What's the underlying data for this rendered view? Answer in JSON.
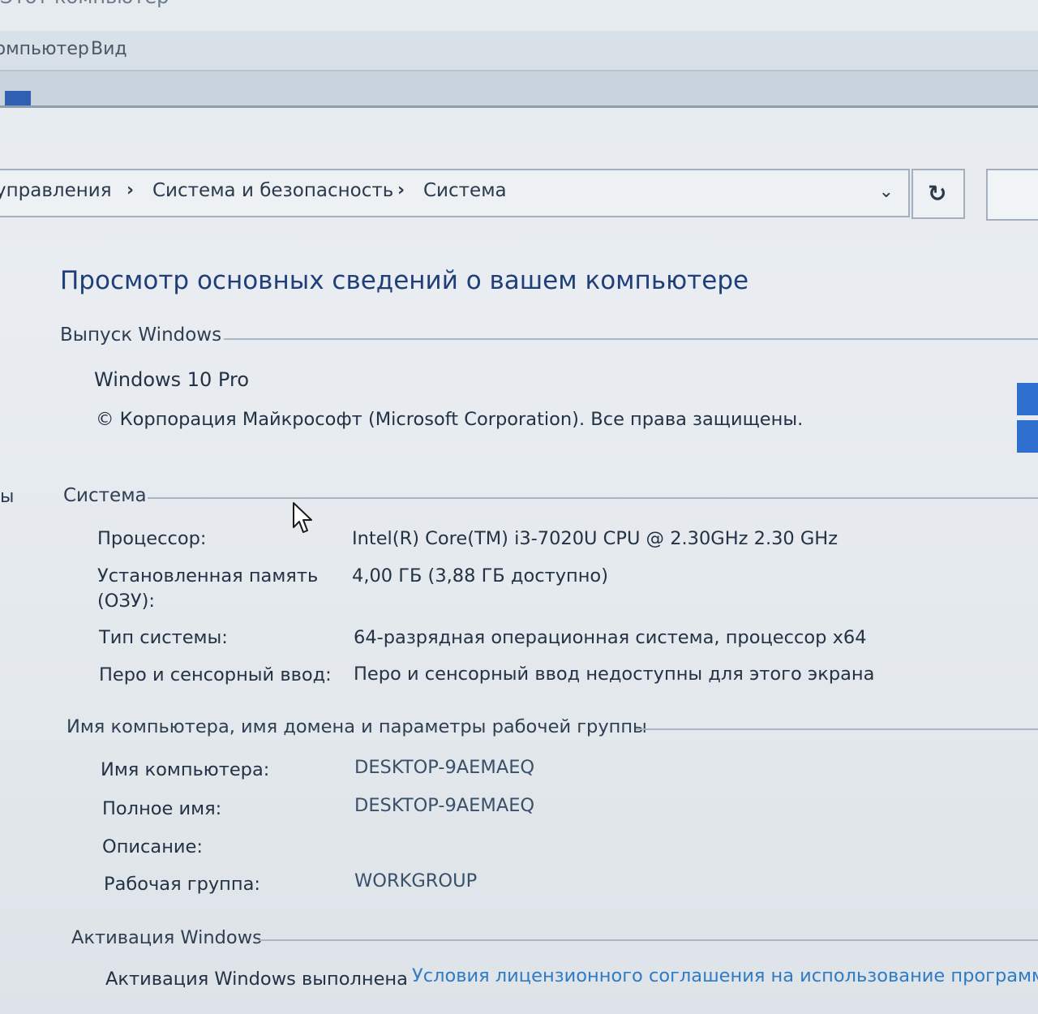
{
  "window": {
    "title": "Этот компьютер"
  },
  "menu": {
    "items": [
      "Компьютер",
      "Вид"
    ]
  },
  "address_bar": {
    "crumbs": [
      "управления",
      "Система и безопасность",
      "Система"
    ],
    "separator": "›",
    "dropdown_icon": "chevron-down-icon",
    "refresh_icon": "refresh-icon"
  },
  "main": {
    "title": "Просмотр основных сведений о вашем компьютере",
    "windows_edition": {
      "header": "Выпуск Windows",
      "edition": "Windows 10 Pro",
      "copyright": "© Корпорация Майкрософт (Microsoft Corporation). Все права защищены."
    },
    "system": {
      "header": "Система",
      "rows": [
        {
          "label": "Процессор:",
          "value": "Intel(R) Core(TM) i3-7020U CPU @ 2.30GHz   2.30 GHz"
        },
        {
          "label": "Установленная память",
          "label2": "(ОЗУ):",
          "value": "4,00 ГБ (3,88 ГБ доступно)"
        },
        {
          "label": "Тип системы:",
          "value": "64-разрядная операционная система, процессор x64"
        },
        {
          "label": "Перо и сенсорный ввод:",
          "value": "Перо и сенсорный ввод недоступны для этого экрана"
        }
      ]
    },
    "computer_name": {
      "header": "Имя компьютера, имя домена и параметры рабочей группы",
      "rows": [
        {
          "label": "Имя компьютера:",
          "value": "DESKTOP-9AEMAEQ"
        },
        {
          "label": "Полное имя:",
          "value": "DESKTOP-9AEMAEQ"
        },
        {
          "label": "Описание:",
          "value": ""
        },
        {
          "label": "Рабочая группа:",
          "value": "WORKGROUP"
        }
      ]
    },
    "activation": {
      "header": "Активация Windows",
      "status": "Активация Windows выполнена",
      "license_link": "Условия лицензионного соглашения на использование программного"
    }
  },
  "colors": {
    "title": "#1f3f7a",
    "link": "#2f7bc4",
    "windows_logo": "#2f6fd0"
  }
}
